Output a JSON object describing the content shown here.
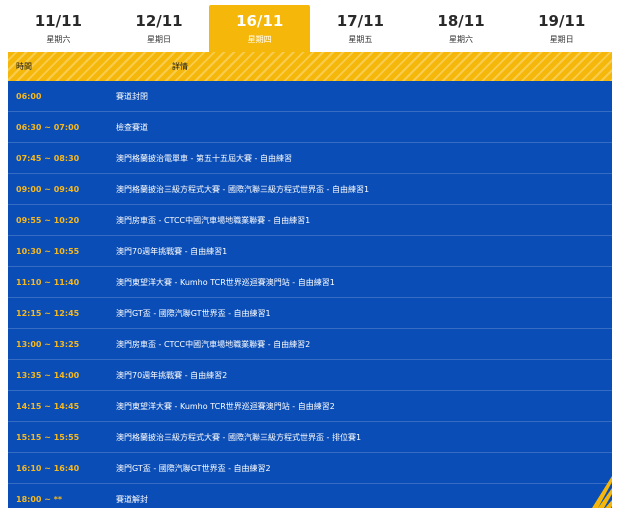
{
  "tabs": [
    {
      "date": "11/11",
      "weekday": "星期六"
    },
    {
      "date": "12/11",
      "weekday": "星期日"
    },
    {
      "date": "16/11",
      "weekday": "星期四"
    },
    {
      "date": "17/11",
      "weekday": "星期五"
    },
    {
      "date": "18/11",
      "weekday": "星期六"
    },
    {
      "date": "19/11",
      "weekday": "星期日"
    }
  ],
  "active_tab": "16/11",
  "colors": {
    "accent": "#f5b80a",
    "panel": "#0a4db6",
    "time": "#f7b81b"
  },
  "header": {
    "time": "時間",
    "detail": "詳情"
  },
  "schedule": [
    {
      "time": "06:00",
      "detail": "賽道封閉"
    },
    {
      "time": "06:30 ~ 07:00",
      "detail": "檢查賽道"
    },
    {
      "time": "07:45 ~ 08:30",
      "detail": "澳門格蘭披治電單車 - 第五十五屆大賽 - 自由練習"
    },
    {
      "time": "09:00 ~ 09:40",
      "detail": "澳門格蘭披治三級方程式大賽 - 國際汽聯三級方程式世界盃 - 自由練習1"
    },
    {
      "time": "09:55 ~ 10:20",
      "detail": "澳門房車盃 - CTCC中國汽車場地職業聯賽 - 自由練習1"
    },
    {
      "time": "10:30 ~ 10:55",
      "detail": "澳門70週年挑戰賽 - 自由練習1"
    },
    {
      "time": "11:10 ~ 11:40",
      "detail": "澳門東望洋大賽 - Kumho TCR世界巡迴賽澳門站 - 自由練習1"
    },
    {
      "time": "12:15 ~ 12:45",
      "detail": "澳門GT盃 - 國際汽聯GT世界盃 - 自由練習1"
    },
    {
      "time": "13:00 ~ 13:25",
      "detail": "澳門房車盃 - CTCC中國汽車場地職業聯賽 - 自由練習2"
    },
    {
      "time": "13:35 ~ 14:00",
      "detail": "澳門70週年挑戰賽 - 自由練習2"
    },
    {
      "time": "14:15 ~ 14:45",
      "detail": "澳門東望洋大賽 - Kumho TCR世界巡迴賽澳門站 - 自由練習2"
    },
    {
      "time": "15:15 ~ 15:55",
      "detail": "澳門格蘭披治三級方程式大賽 - 國際汽聯三級方程式世界盃 - 排位賽1"
    },
    {
      "time": "16:10 ~ 16:40",
      "detail": "澳門GT盃 - 國際汽聯GT世界盃 - 自由練習2"
    },
    {
      "time": "18:00 ~ **",
      "detail": "賽道解封"
    }
  ]
}
